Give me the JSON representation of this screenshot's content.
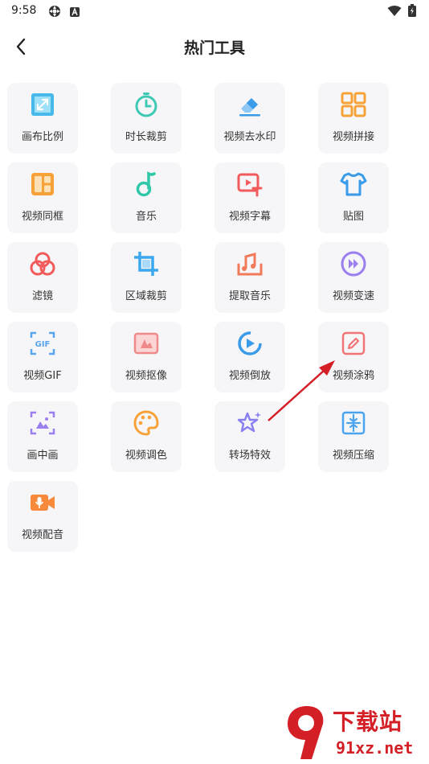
{
  "status_bar": {
    "time": "9:58"
  },
  "header": {
    "title": "热门工具",
    "back_icon": "back-arrow-icon"
  },
  "tools": [
    {
      "label": "画布比例",
      "icon": "canvas-ratio-icon",
      "color": "#3fb6e6"
    },
    {
      "label": "时长裁剪",
      "icon": "timer-icon",
      "color": "#3ec9b4"
    },
    {
      "label": "视频去水印",
      "icon": "eraser-icon",
      "color": "#4aa3ee"
    },
    {
      "label": "视频拼接",
      "icon": "grid-icon",
      "color": "#f7a238"
    },
    {
      "label": "视频同框",
      "icon": "layout-icon",
      "color": "#f7a238"
    },
    {
      "label": "音乐",
      "icon": "music-note-icon",
      "color": "#2fc7a8"
    },
    {
      "label": "视频字幕",
      "icon": "subtitle-icon",
      "color": "#f15b5b"
    },
    {
      "label": "贴图",
      "icon": "shirt-icon",
      "color": "#4aa3ee"
    },
    {
      "label": "滤镜",
      "icon": "filter-icon",
      "color": "#f15b5b"
    },
    {
      "label": "区域裁剪",
      "icon": "crop-icon",
      "color": "#3aa7ee"
    },
    {
      "label": "提取音乐",
      "icon": "extract-music-icon",
      "color": "#f07a5a"
    },
    {
      "label": "视频变速",
      "icon": "speed-icon",
      "color": "#9b7ff0"
    },
    {
      "label": "视频GIF",
      "icon": "gif-icon",
      "color": "#5aa6ee"
    },
    {
      "label": "视频抠像",
      "icon": "cutout-icon",
      "color": "#f08a8a"
    },
    {
      "label": "视频倒放",
      "icon": "reverse-play-icon",
      "color": "#3a9be8"
    },
    {
      "label": "视频涂鸦",
      "icon": "doodle-icon",
      "color": "#f27474"
    },
    {
      "label": "画中画",
      "icon": "pip-icon",
      "color": "#9b7ff0"
    },
    {
      "label": "视频调色",
      "icon": "palette-icon",
      "color": "#f7a238"
    },
    {
      "label": "转场特效",
      "icon": "sparkle-star-icon",
      "color": "#8a7ff0"
    },
    {
      "label": "视频压缩",
      "icon": "compress-icon",
      "color": "#4aa3ee"
    },
    {
      "label": "视频配音",
      "icon": "voiceover-icon",
      "color": "#f7893a"
    }
  ],
  "watermark": {
    "main": "下载站",
    "sub": "91xz.net"
  }
}
